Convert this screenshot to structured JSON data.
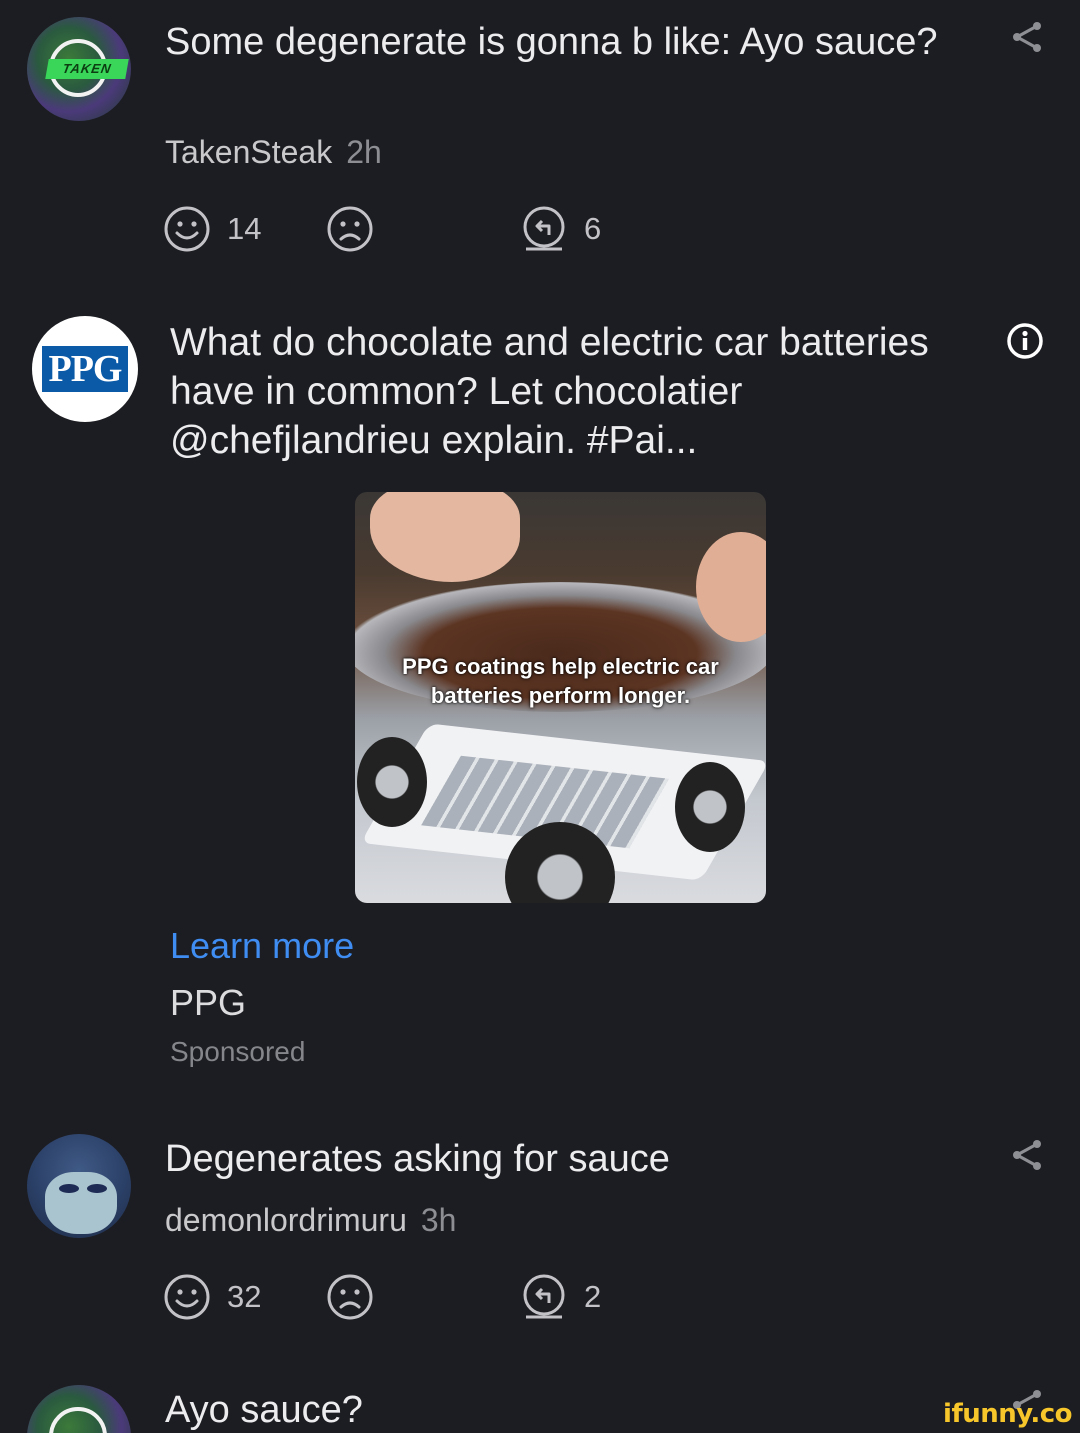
{
  "comments": [
    {
      "text": "Some degenerate is gonna b like: Ayo sauce?",
      "username": "TakenSteak",
      "time": "2h",
      "likes": "14",
      "replies": "6",
      "avatar_badge": "TAKEN"
    },
    {
      "text": "Degenerates asking for sauce",
      "username": "demonlordrimuru",
      "time": "3h",
      "likes": "32",
      "replies": "2"
    },
    {
      "text": "Ayo sauce?"
    }
  ],
  "ad": {
    "logo_text": "PPG",
    "text": "What do chocolate and electric car batteries have in common? Let chocolatier @chefjlandrieu explain. #Pai...",
    "image_caption": "PPG coatings help electric car batteries perform longer.",
    "cta": "Learn more",
    "brand": "PPG",
    "sponsored_label": "Sponsored"
  },
  "watermark": "ifunny.co",
  "icons": {
    "like": "smile-icon",
    "dislike": "frown-icon",
    "reply": "reply-icon",
    "share": "share-icon",
    "info": "info-icon"
  },
  "colors": {
    "background": "#1c1d22",
    "link": "#3f8df2",
    "watermark": "#f7c62a"
  }
}
